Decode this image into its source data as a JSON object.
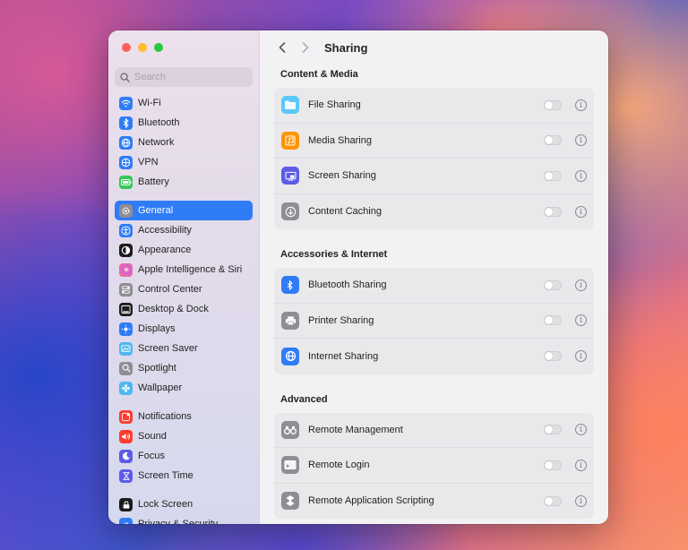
{
  "sidebar": {
    "search_placeholder": "Search",
    "groups": [
      [
        {
          "label": "Wi-Fi",
          "icon": "wifi-icon",
          "color": "#2f7cf6"
        },
        {
          "label": "Bluetooth",
          "icon": "bluetooth-icon",
          "color": "#2f7cf6"
        },
        {
          "label": "Network",
          "icon": "network-icon",
          "color": "#2f7cf6"
        },
        {
          "label": "VPN",
          "icon": "vpn-icon",
          "color": "#2f7cf6"
        },
        {
          "label": "Battery",
          "icon": "battery-icon",
          "color": "#34c759"
        }
      ],
      [
        {
          "label": "General",
          "icon": "gear-icon",
          "color": "#8e8e93",
          "selected": true
        },
        {
          "label": "Accessibility",
          "icon": "accessibility-icon",
          "color": "#2f7cf6"
        },
        {
          "label": "Appearance",
          "icon": "appearance-icon",
          "color": "#1c1c1e"
        },
        {
          "label": "Apple Intelligence & Siri",
          "icon": "siri-icon",
          "color": "#e86aa8"
        },
        {
          "label": "Control Center",
          "icon": "control-center-icon",
          "color": "#8e8e93"
        },
        {
          "label": "Desktop & Dock",
          "icon": "dock-icon",
          "color": "#1c1c1e"
        },
        {
          "label": "Displays",
          "icon": "displays-icon",
          "color": "#2f7cf6"
        },
        {
          "label": "Screen Saver",
          "icon": "screen-saver-icon",
          "color": "#4fb8f0"
        },
        {
          "label": "Spotlight",
          "icon": "spotlight-icon",
          "color": "#8e8e93"
        },
        {
          "label": "Wallpaper",
          "icon": "wallpaper-icon",
          "color": "#4fb8f0"
        }
      ],
      [
        {
          "label": "Notifications",
          "icon": "notifications-icon",
          "color": "#ff3b30"
        },
        {
          "label": "Sound",
          "icon": "sound-icon",
          "color": "#ff3b30"
        },
        {
          "label": "Focus",
          "icon": "focus-icon",
          "color": "#5e5ce6"
        },
        {
          "label": "Screen Time",
          "icon": "screen-time-icon",
          "color": "#5e5ce6"
        }
      ],
      [
        {
          "label": "Lock Screen",
          "icon": "lock-icon",
          "color": "#1c1c1e"
        },
        {
          "label": "Privacy & Security",
          "icon": "privacy-icon",
          "color": "#2f7cf6"
        }
      ]
    ]
  },
  "main": {
    "title": "Sharing",
    "sections": [
      {
        "title": "Content & Media",
        "items": [
          {
            "label": "File Sharing",
            "icon": "folder-icon",
            "color": "#5ac8fa",
            "on": false
          },
          {
            "label": "Media Sharing",
            "icon": "music-icon",
            "color": "#ff9500",
            "on": false
          },
          {
            "label": "Screen Sharing",
            "icon": "screen-sharing-icon",
            "color": "#5e5ce6",
            "on": false
          },
          {
            "label": "Content Caching",
            "icon": "content-caching-icon",
            "color": "#8e8e93",
            "on": false
          }
        ]
      },
      {
        "title": "Accessories & Internet",
        "items": [
          {
            "label": "Bluetooth Sharing",
            "icon": "bluetooth-icon",
            "color": "#2f7cf6",
            "on": false
          },
          {
            "label": "Printer Sharing",
            "icon": "printer-icon",
            "color": "#8e8e93",
            "on": false
          },
          {
            "label": "Internet Sharing",
            "icon": "globe-icon",
            "color": "#2f7cf6",
            "on": false
          }
        ]
      },
      {
        "title": "Advanced",
        "items": [
          {
            "label": "Remote Management",
            "icon": "binoculars-icon",
            "color": "#8e8e93",
            "on": false
          },
          {
            "label": "Remote Login",
            "icon": "terminal-icon",
            "color": "#8e8e93",
            "on": false
          },
          {
            "label": "Remote Application Scripting",
            "icon": "script-icon",
            "color": "#8e8e93",
            "on": false
          }
        ]
      }
    ]
  }
}
